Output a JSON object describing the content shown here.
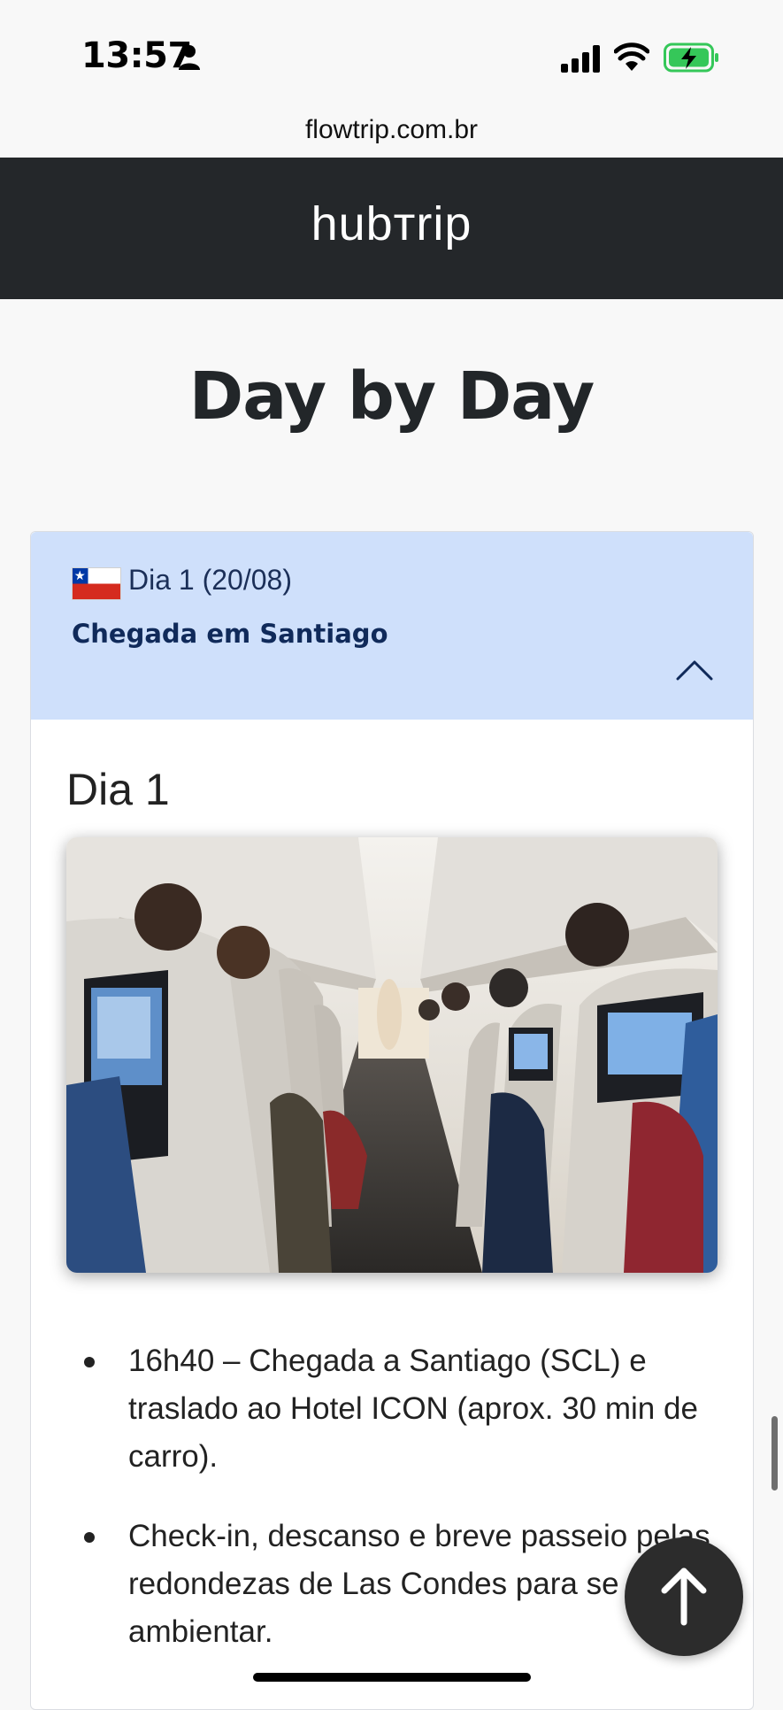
{
  "status_bar": {
    "time": "13:57"
  },
  "browser": {
    "url": "flowtrip.com.br"
  },
  "header": {
    "logo": "hubтrip"
  },
  "page": {
    "title": "Day by Day"
  },
  "day": {
    "label": "Dia 1 (20/08)",
    "subtitle": "Chegada em Santiago",
    "heading": "Dia 1",
    "flag_icon": "chile-flag-icon",
    "activities": [
      "16h40 – Chegada a Santiago (SCL) e traslado ao Hotel ICON (aprox. 30 min de carro).",
      "Check-in, descanso e breve passeio pelas redondezas de Las Condes para se ambientar."
    ]
  },
  "colors": {
    "header_bg": "#24272a",
    "accordion_bg": "#cfe0fb",
    "accent_text": "#102a5a",
    "battery_fill": "#35c759"
  }
}
